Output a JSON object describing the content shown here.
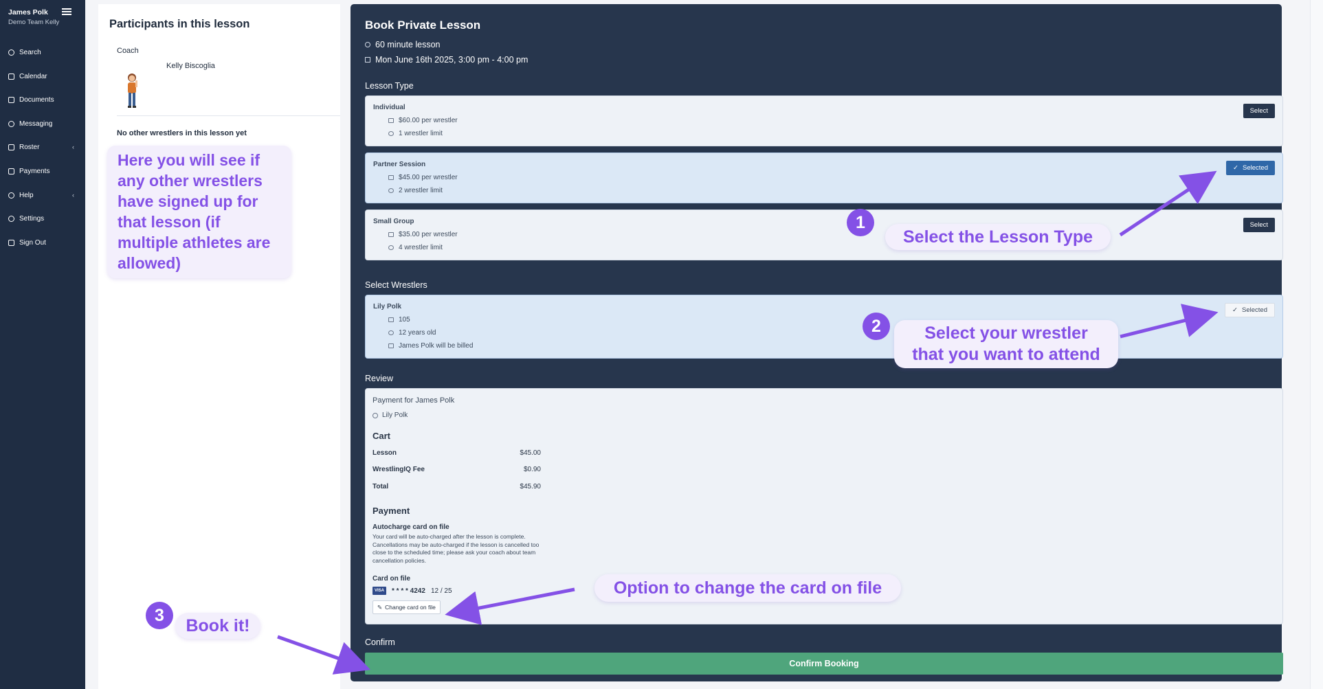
{
  "sidebar": {
    "user_name": "James Polk",
    "team_name": "Demo Team Kelly",
    "items": [
      {
        "label": "Search",
        "icon": "search-icon"
      },
      {
        "label": "Calendar",
        "icon": "calendar-icon"
      },
      {
        "label": "Documents",
        "icon": "document-icon"
      },
      {
        "label": "Messaging",
        "icon": "chat-icon"
      },
      {
        "label": "Roster",
        "icon": "users-icon",
        "chevron": "‹"
      },
      {
        "label": "Payments",
        "icon": "credit-card-icon"
      },
      {
        "label": "Help",
        "icon": "help-icon",
        "chevron": "‹"
      },
      {
        "label": "Settings",
        "icon": "gear-icon"
      },
      {
        "label": "Sign Out",
        "icon": "sign-out-icon"
      }
    ]
  },
  "participants": {
    "title": "Participants in this lesson",
    "coach_label": "Coach",
    "coach_name": "Kelly Biscoglia",
    "no_others": "No other wrestlers in this lesson yet"
  },
  "booking": {
    "title": "Book Private Lesson",
    "duration": "60 minute lesson",
    "datetime": "Mon June 16th 2025, 3:00 pm - 4:00 pm",
    "lesson_type_label": "Lesson Type",
    "lesson_types": [
      {
        "name": "Individual",
        "price": "$60.00 per wrestler",
        "limit": "1 wrestler limit",
        "button": "Select",
        "selected": false
      },
      {
        "name": "Partner Session",
        "price": "$45.00 per wrestler",
        "limit": "2 wrestler limit",
        "button": "Selected",
        "selected": true
      },
      {
        "name": "Small Group",
        "price": "$35.00 per wrestler",
        "limit": "4 wrestler limit",
        "button": "Select",
        "selected": false
      }
    ],
    "select_wrestlers_label": "Select Wrestlers",
    "wrestler": {
      "name": "Lily Polk",
      "weight": "105",
      "age": "12 years old",
      "billing": "James Polk will be billed",
      "button": "Selected"
    },
    "review_label": "Review",
    "review": {
      "payment_for": "Payment for James Polk",
      "wrestler": "Lily Polk",
      "cart_title": "Cart",
      "cart": [
        {
          "label": "Lesson",
          "value": "$45.00"
        },
        {
          "label": "WrestlingIQ Fee",
          "value": "$0.90"
        },
        {
          "label": "Total",
          "value": "$45.90"
        }
      ],
      "payment_title": "Payment",
      "autocharge_title": "Autocharge card on file",
      "autocharge_text": "Your card will be auto-charged after the lesson is complete. Cancellations may be auto-charged if the lesson is cancelled too close to the scheduled time; please ask your coach about team cancellation policies.",
      "card_on_file_label": "Card on file",
      "card_brand": "VISA",
      "card_number": "* * * * 4242",
      "card_expiry": "12 / 25",
      "change_card_label": "Change card on file"
    },
    "confirm_label": "Confirm",
    "confirm_button": "Confirm Booking"
  },
  "annotations": {
    "participants_note": "Here you will see if any other wrestlers have signed up for that lesson (if multiple athletes are allowed)",
    "step1_number": "1",
    "step1_text": "Select the Lesson Type",
    "step2_number": "2",
    "step2_line1": "Select your wrestler",
    "step2_line2": "that you want to attend",
    "card_note": "Option to change the card on file",
    "step3_number": "3",
    "step3_text": "Book it!",
    "accent_color": "#8451e6"
  }
}
